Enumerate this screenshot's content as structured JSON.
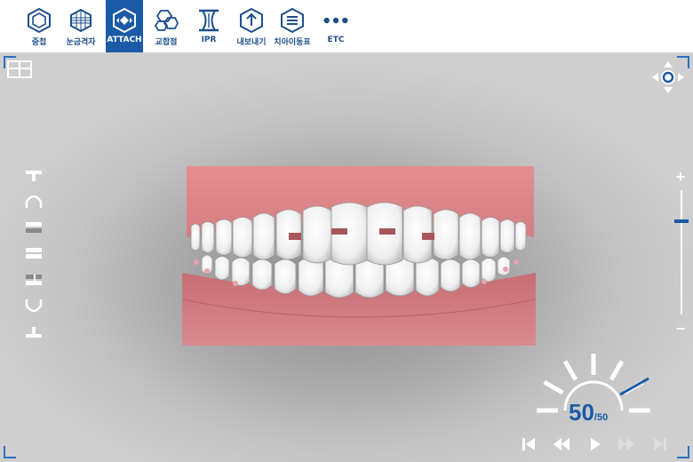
{
  "toolbar": {
    "tools": [
      {
        "label": "중첩",
        "icon": "overlay-hexagon-icon"
      },
      {
        "label": "눈금격자",
        "icon": "grid-icon"
      },
      {
        "label": "ATTACH",
        "icon": "attach-icon",
        "active": true
      },
      {
        "label": "교합점",
        "icon": "occlusion-icon"
      },
      {
        "label": "IPR",
        "icon": "ipr-icon"
      },
      {
        "label": "내보내기",
        "icon": "export-icon"
      },
      {
        "label": "치아이동표",
        "icon": "movement-table-icon"
      },
      {
        "label": "ETC",
        "icon": "more-dots-icon"
      }
    ],
    "active_color": "#1a5aa6",
    "icon_color": "#1d4f8c"
  },
  "viewport": {
    "left_view_buttons": [
      "upper-jaw-top-icon",
      "upper-arch-icon",
      "upper-half-icon",
      "both-jaw-icon",
      "split-jaw-icon",
      "lower-arch-icon",
      "lower-jaw-bottom-icon"
    ],
    "zoom": {
      "plus_label": "+",
      "minus_label": "−",
      "level": 0.75
    },
    "stage": {
      "current": "50",
      "total": "/50"
    },
    "playback": [
      "skip-first-icon",
      "rewind-icon",
      "play-icon",
      "fast-forward-icon",
      "skip-last-icon"
    ]
  }
}
